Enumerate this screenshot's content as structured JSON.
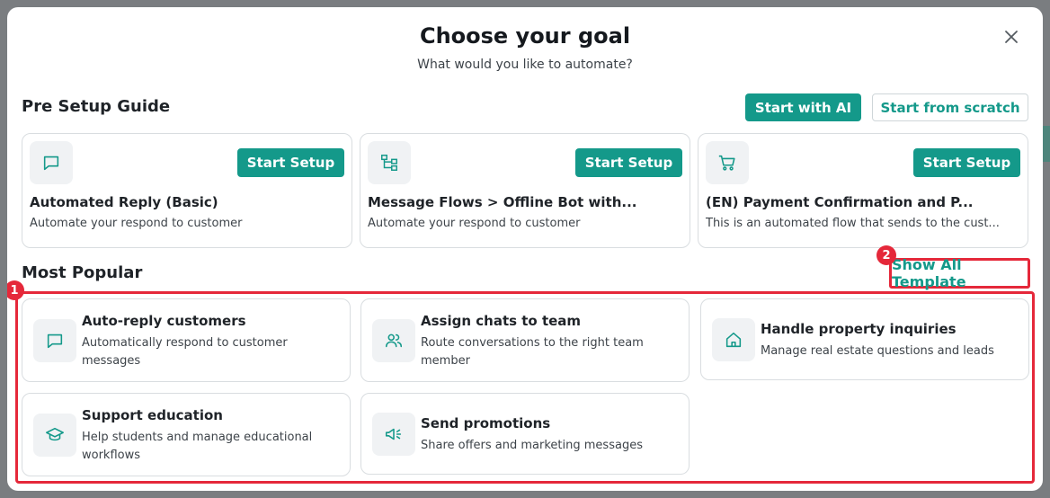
{
  "modal": {
    "title": "Choose your goal",
    "subtitle": "What would you like to automate?"
  },
  "pre_setup": {
    "heading": "Pre Setup Guide",
    "start_ai_label": "Start with AI",
    "start_scratch_label": "Start from scratch",
    "cards": [
      {
        "icon": "chat-bubble-icon",
        "title": "Automated Reply (Basic)",
        "description": "Automate your respond to customer",
        "button": "Start Setup"
      },
      {
        "icon": "flow-icon",
        "title": "Message Flows > Offline Bot with...",
        "description": "Automate your respond to customer",
        "button": "Start Setup"
      },
      {
        "icon": "cart-icon",
        "title": "(EN) Payment Confirmation and P...",
        "description": "This is an automated flow that sends to the cust...",
        "button": "Start Setup"
      }
    ]
  },
  "most_popular": {
    "heading": "Most Popular",
    "show_all_label": "Show All Template",
    "badges": [
      "1",
      "2"
    ],
    "items": [
      {
        "icon": "chat-bubble-icon",
        "title": "Auto-reply customers",
        "description": "Automatically respond to customer messages"
      },
      {
        "icon": "team-icon",
        "title": "Assign chats to team",
        "description": "Route conversations to the right team member"
      },
      {
        "icon": "house-icon",
        "title": "Handle property inquiries",
        "description": "Manage real estate questions and leads"
      },
      {
        "icon": "graduation-cap-icon",
        "title": "Support education",
        "description": "Help students and manage educational workflows"
      },
      {
        "icon": "megaphone-icon",
        "title": "Send promotions",
        "description": "Share offers and marketing messages"
      }
    ]
  },
  "colors": {
    "accent": "#14998a",
    "highlight": "#e5283a"
  }
}
